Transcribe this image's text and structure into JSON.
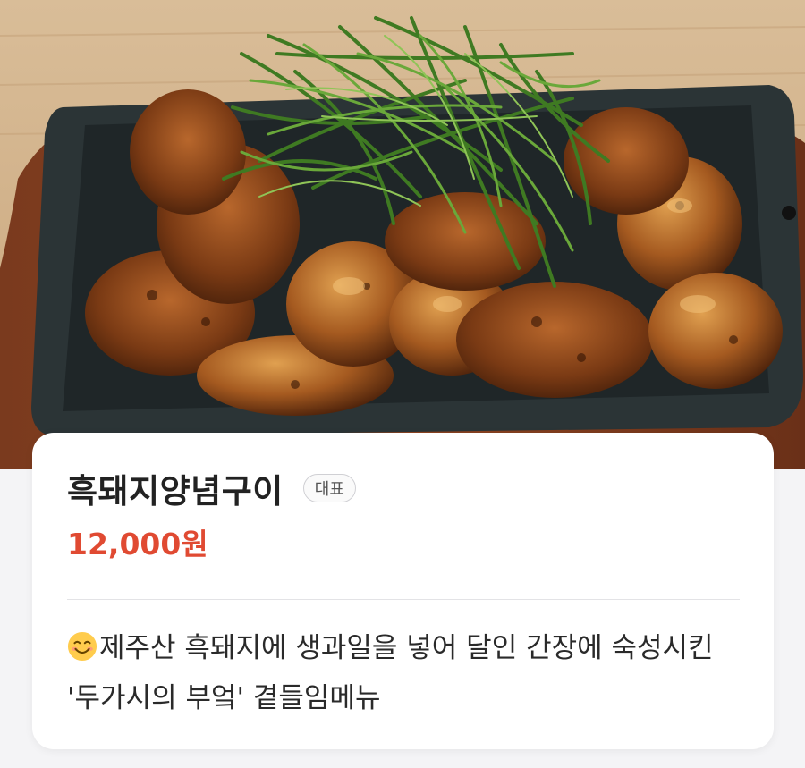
{
  "photo": {
    "alt_icon": "food-photo"
  },
  "menu": {
    "name": "흑돼지양념구이",
    "badge": "대표",
    "price": "12,000원",
    "description_emoji": "smiling-face-icon",
    "description": "제주산 흑돼지에 생과일을 넣어 달인 간장에 숙성시킨 '두가시의 부엌' 곁들임메뉴"
  },
  "colors": {
    "price": "#e04a32",
    "title": "#222222",
    "badge_border": "#d0d0d4"
  }
}
